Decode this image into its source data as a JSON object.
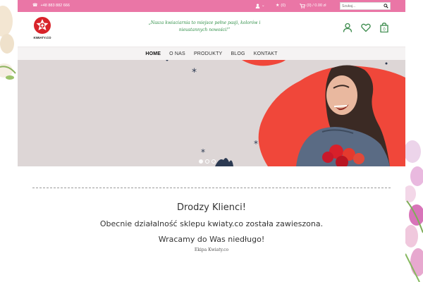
{
  "topbar": {
    "phone": "+48 883 882 666",
    "account_caret": "⌄",
    "wishlist_count": "(0)",
    "cart_summary": "(0) / 0.00 zł",
    "search_placeholder": "Szukaj..."
  },
  "header": {
    "logo_text": "KWIATY.CO",
    "quote": "„Nasza kwiaciarnia to miejsce pełne pasji, kolorów i nieustannych nowości!”",
    "cart_count": "0"
  },
  "nav": {
    "items": [
      {
        "label": "HOME"
      },
      {
        "label": "O NAS"
      },
      {
        "label": "PRODUKTY"
      },
      {
        "label": "BLOG"
      },
      {
        "label": "KONTAKT"
      }
    ]
  },
  "hero": {
    "slides": 3,
    "active_slide": 1
  },
  "message": {
    "title": "Drodzy Klienci!",
    "line1": "Obecnie działalność sklepu kwiaty.co została zawieszona.",
    "line2": "Wracamy do Was niedługo!",
    "signature": "Ekipa Kwiaty.co"
  },
  "colors": {
    "topbar": "#ea76a6",
    "accent_green": "#2f8f47",
    "hero_bg": "#ddd6d6",
    "hero_red": "#f0473a"
  },
  "icons": {
    "phone": "phone-icon",
    "account": "user-icon",
    "wishlist": "star-icon",
    "cart": "cart-icon",
    "search": "search-icon",
    "header_account": "user-icon",
    "header_wishlist": "heart-icon",
    "header_cart": "bag-icon"
  }
}
